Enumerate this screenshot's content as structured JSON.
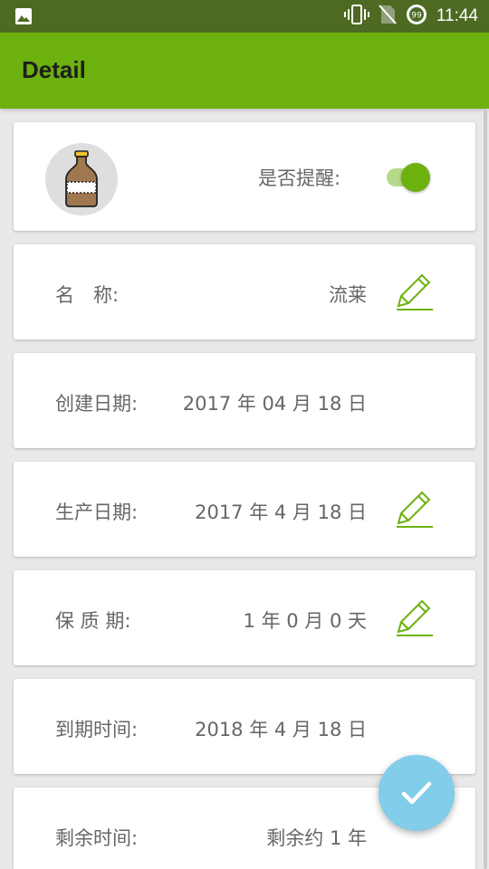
{
  "status_bar": {
    "time": "11:44",
    "icons": [
      "image-icon",
      "vibrate-icon",
      "no-sim-icon",
      "battery-99-icon"
    ],
    "battery_badge": "99"
  },
  "app_bar": {
    "title": "Detail"
  },
  "header_card": {
    "avatar_icon": "bottle-icon",
    "reminder_label": "是否提醒:",
    "reminder_on": true
  },
  "rows": [
    {
      "label": "名　称:",
      "value": "流莱",
      "editable": true
    },
    {
      "label": "创建日期:",
      "value": "2017 年 04 月 18 日",
      "editable": false
    },
    {
      "label": "生产日期:",
      "value": "2017 年 4 月 18 日",
      "editable": true
    },
    {
      "label": "保 质 期:",
      "value": "1 年 0 月 0 天",
      "editable": true
    },
    {
      "label": "到期时间:",
      "value": "2018 年 4 月 18 日",
      "editable": false
    },
    {
      "label": "剩余时间:",
      "value": "剩余约 1 年",
      "editable": false
    }
  ],
  "fab": {
    "icon": "check-icon"
  },
  "colors": {
    "app_bar": "#6db10e",
    "status_bar": "#4e6a22",
    "accent": "#6db10e",
    "fab": "#81cdea"
  }
}
